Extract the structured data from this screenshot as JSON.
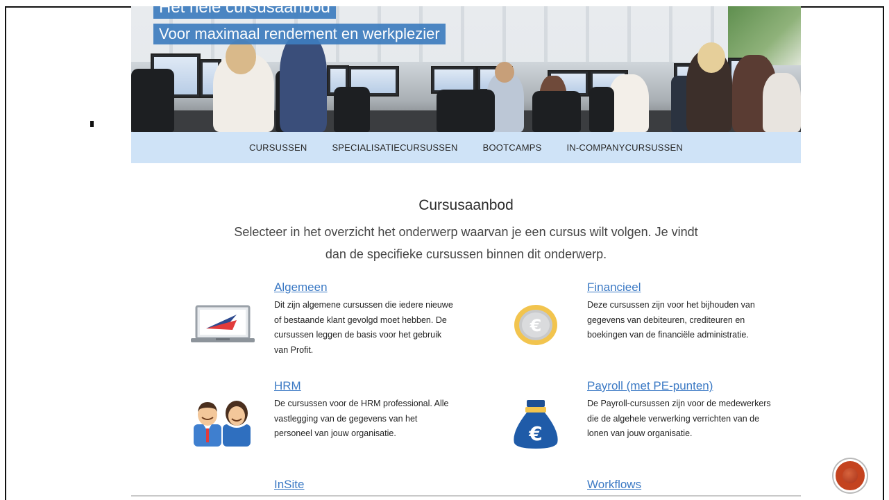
{
  "hero": {
    "title": "Het hele cursusaanbod",
    "subtitle": "Voor maximaal rendement en werkplezier"
  },
  "nav": {
    "items": [
      "CURSUSSEN",
      "SPECIALISATIECURSUSSEN",
      "BOOTCAMPS",
      "IN-COMPANYCURSUSSEN"
    ]
  },
  "content": {
    "title": "Cursusaanbod",
    "intro": "Selecteer in het overzicht het onderwerp waarvan je een cursus wilt volgen. Je vindt dan de specifieke cursussen binnen dit onderwerp."
  },
  "courses": [
    {
      "heading": "Algemeen",
      "icon": "laptop-icon",
      "desc": "Dit zijn algemene cursussen die iedere nieuwe of bestaande klant gevolgd moet hebben. De cursussen leggen de basis voor het gebruik van Profit."
    },
    {
      "heading": "Financieel",
      "icon": "euro-coin-icon",
      "desc": "Deze cursussen zijn voor het bijhouden van gegevens van debiteuren, crediteuren en boekingen van de financiële administratie."
    },
    {
      "heading": "HRM",
      "icon": "people-icon",
      "desc": "De cursussen voor de HRM professional. Alle vastlegging van de gegevens van het personeel van jouw organisatie."
    },
    {
      "heading": "Payroll (met PE-punten)",
      "icon": "money-bag-icon",
      "desc": "De Payroll-cursussen zijn voor de medewerkers die de algehele verwerking verrichten van de lonen van jouw organisatie."
    },
    {
      "heading": "InSite",
      "icon": "",
      "desc": ""
    },
    {
      "heading": "Workflows",
      "icon": "",
      "desc": ""
    }
  ],
  "colors": {
    "accent": "#3e7dbf",
    "link": "#3b79c4",
    "nav_bg": "#cfe3f7",
    "button": "#c4431f"
  }
}
